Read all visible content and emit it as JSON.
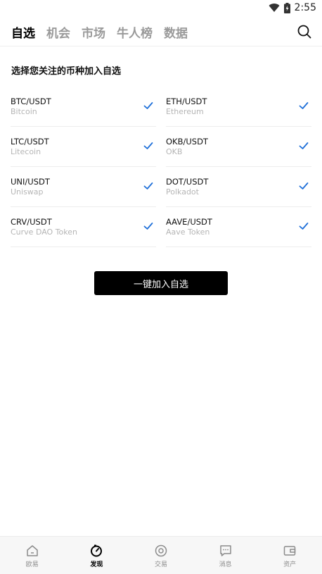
{
  "status_bar": {
    "time": "2:55"
  },
  "top_tabs": [
    {
      "label": "自选",
      "active": true
    },
    {
      "label": "机会",
      "active": false
    },
    {
      "label": "市场",
      "active": false
    },
    {
      "label": "牛人榜",
      "active": false
    },
    {
      "label": "数据",
      "active": false
    }
  ],
  "section_title": "选择您关注的币种加入自选",
  "coins": [
    {
      "pair": "BTC/USDT",
      "name": "Bitcoin",
      "selected": true
    },
    {
      "pair": "ETH/USDT",
      "name": "Ethereum",
      "selected": true
    },
    {
      "pair": "LTC/USDT",
      "name": "Litecoin",
      "selected": true
    },
    {
      "pair": "OKB/USDT",
      "name": "OKB",
      "selected": true
    },
    {
      "pair": "UNI/USDT",
      "name": "Uniswap",
      "selected": true
    },
    {
      "pair": "DOT/USDT",
      "name": "Polkadot",
      "selected": true
    },
    {
      "pair": "CRV/USDT",
      "name": "Curve DAO Token",
      "selected": true
    },
    {
      "pair": "AAVE/USDT",
      "name": "Aave Token",
      "selected": true
    }
  ],
  "add_all_label": "一键加入自选",
  "bottom_nav": [
    {
      "label": "欧易",
      "icon": "home-icon",
      "active": false
    },
    {
      "label": "发现",
      "icon": "discover-icon",
      "active": true
    },
    {
      "label": "交易",
      "icon": "trade-icon",
      "active": false
    },
    {
      "label": "消息",
      "icon": "message-icon",
      "active": false
    },
    {
      "label": "资产",
      "icon": "wallet-icon",
      "active": false
    }
  ],
  "colors": {
    "accent": "#1e6fd9",
    "button_bg": "#000000",
    "inactive_text": "#9a9a9a"
  }
}
